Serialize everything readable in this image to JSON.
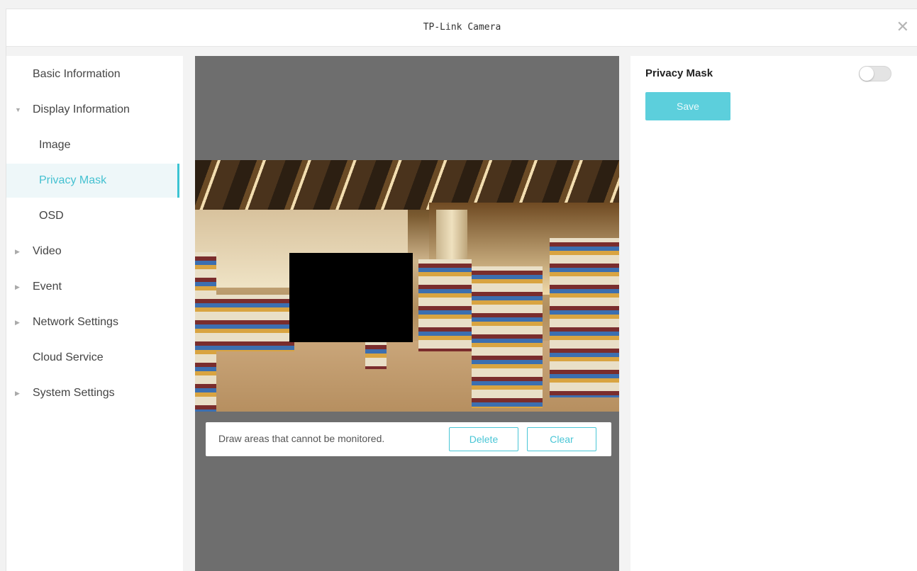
{
  "window": {
    "title": "TP-Link Camera",
    "close_icon": "close-icon",
    "close_glyph": "✕"
  },
  "sidebar": {
    "items": [
      {
        "label": "Basic Information",
        "arrow": ""
      },
      {
        "label": "Display Information",
        "arrow": "▼"
      },
      {
        "label": "Image",
        "arrow": ""
      },
      {
        "label": "Privacy Mask",
        "arrow": "",
        "active": true
      },
      {
        "label": "OSD",
        "arrow": ""
      },
      {
        "label": "Video",
        "arrow": "▶"
      },
      {
        "label": "Event",
        "arrow": "▶"
      },
      {
        "label": "Network Settings",
        "arrow": "▶"
      },
      {
        "label": "Cloud Service",
        "arrow": ""
      },
      {
        "label": "System Settings",
        "arrow": "▶"
      }
    ],
    "active_color": "#45c1d1"
  },
  "viewer": {
    "hint": "Draw areas that cannot be monitored.",
    "delete_label": "Delete",
    "clear_label": "Clear"
  },
  "panel": {
    "title": "Privacy Mask",
    "toggle_on": false,
    "save_label": "Save",
    "accent": "#5ccfdc"
  }
}
